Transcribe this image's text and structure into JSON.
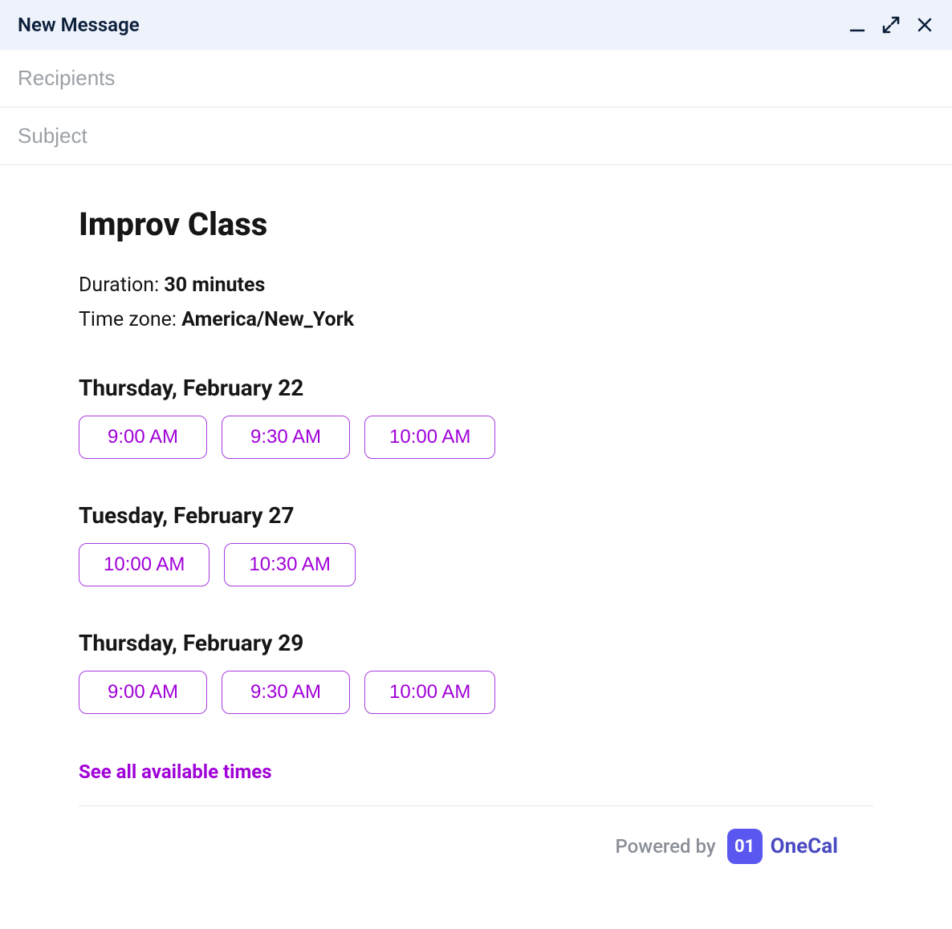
{
  "window": {
    "title": "New Message"
  },
  "fields": {
    "recipients_placeholder": "Recipients",
    "recipients_value": "",
    "subject_placeholder": "Subject",
    "subject_value": ""
  },
  "event": {
    "title": "Improv Class",
    "duration_label": "Duration: ",
    "duration_value": "30 minutes",
    "timezone_label": "Time zone: ",
    "timezone_value": "America/New_York"
  },
  "dates": [
    {
      "heading": "Thursday, February 22",
      "slots": [
        "9:00 AM",
        "9:30 AM",
        "10:00 AM"
      ]
    },
    {
      "heading": "Tuesday, February 27",
      "slots": [
        "10:00 AM",
        "10:30 AM"
      ]
    },
    {
      "heading": "Thursday, February 29",
      "slots": [
        "9:00 AM",
        "9:30 AM",
        "10:00 AM"
      ]
    }
  ],
  "see_all": "See all available times",
  "footer": {
    "powered_by": "Powered by",
    "brand_badge": "01",
    "brand_name": "OneCal"
  }
}
